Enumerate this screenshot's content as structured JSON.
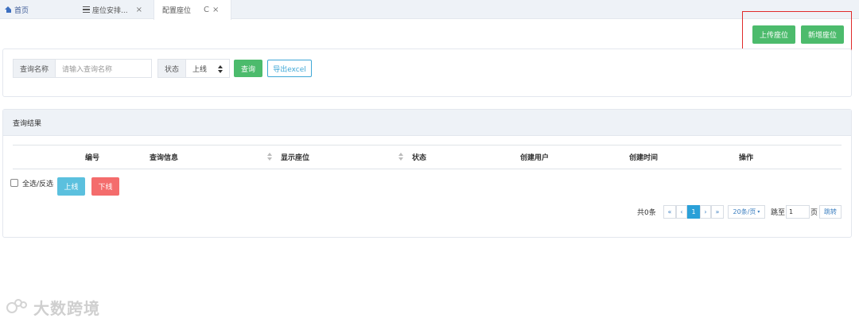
{
  "tabs": [
    {
      "label": "首页",
      "icon": "home-icon"
    },
    {
      "label": "座位安排...",
      "icon": "list-icon",
      "close": "×"
    },
    {
      "label": "配置座位",
      "reload": "C",
      "close": "×"
    }
  ],
  "toolbar": {
    "upload_label": "上传座位",
    "add_label": "新增座位"
  },
  "search": {
    "name_label": "查询名称",
    "name_placeholder": "请输入查询名称",
    "status_label": "状态",
    "status_value": "上线",
    "query_label": "查询",
    "export_label": "导出excel"
  },
  "results": {
    "title": "查询结果",
    "columns": [
      "编号",
      "查询信息",
      "显示座位",
      "状态",
      "创建用户",
      "创建时间",
      "操作"
    ],
    "select_all_label": "全选/反选",
    "online_label": "上线",
    "offline_label": "下线"
  },
  "pagination": {
    "total": "共0条",
    "first": "«",
    "prev": "‹",
    "current": "1",
    "next": "›",
    "last": "»",
    "page_size": "20条/页",
    "goto_prefix": "跳至",
    "goto_value": "1",
    "goto_suffix": "页",
    "goto_button": "跳转"
  },
  "watermark": {
    "text": "大数跨境"
  },
  "colors": {
    "green": "#4cbb6c",
    "cyan": "#5bc0de",
    "red": "#f46c6c",
    "highlight": "#e02b2b",
    "page_active": "#2aa0d8"
  }
}
